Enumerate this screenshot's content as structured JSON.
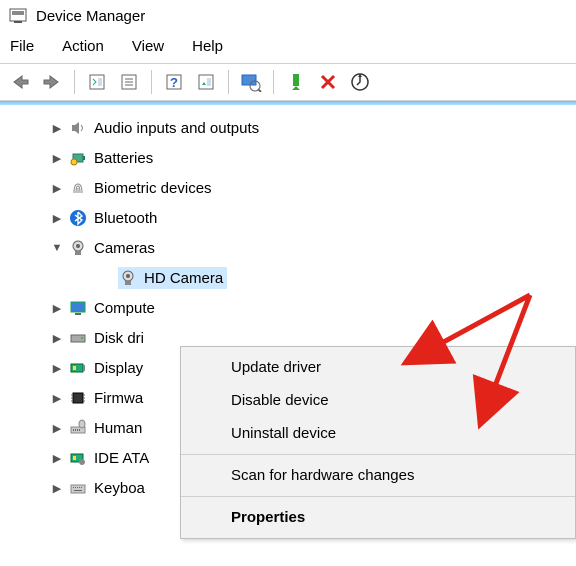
{
  "title": "Device Manager",
  "menu": {
    "file": "File",
    "action": "Action",
    "view": "View",
    "help": "Help"
  },
  "tree": {
    "audio": "Audio inputs and outputs",
    "batteries": "Batteries",
    "biometric": "Biometric devices",
    "bluetooth": "Bluetooth",
    "cameras": "Cameras",
    "hd_camera": "HD Camera",
    "computer": "Compute",
    "disk": "Disk dri",
    "display": "Display",
    "firmware": "Firmwa",
    "human": "Human",
    "ide": "IDE ATA",
    "keyboard": "Keyboa"
  },
  "context_menu": {
    "update": "Update driver",
    "disable": "Disable device",
    "uninstall": "Uninstall device",
    "scan": "Scan for hardware changes",
    "properties": "Properties"
  }
}
